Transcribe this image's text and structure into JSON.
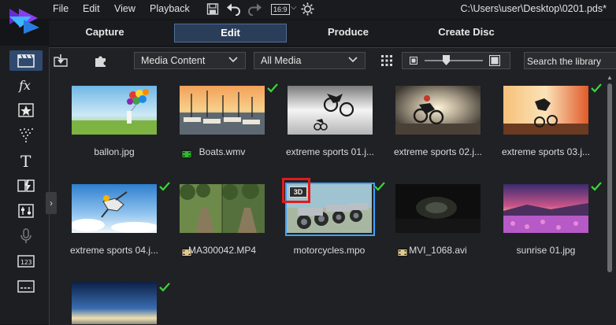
{
  "menu": {
    "items": [
      "File",
      "Edit",
      "View",
      "Playback"
    ],
    "aspect_ratio": "16:9",
    "project_path": "C:\\Users\\user\\Desktop\\0201.pds*"
  },
  "tabs": [
    "Capture",
    "Edit",
    "Produce",
    "Create Disc"
  ],
  "active_tab": "Edit",
  "left_toolbar": [
    "media-room-icon",
    "fx-room-icon",
    "pip-objects-icon",
    "particle-room-icon",
    "title-room-icon",
    "transition-room-icon",
    "audio-mixing-icon",
    "voiceover-icon",
    "chapter-room-icon",
    "subtitle-room-icon"
  ],
  "library": {
    "content_filter": "Media Content",
    "media_filter": "All Media",
    "search_placeholder": "Search the library",
    "items": [
      {
        "name": "ballon.jpg",
        "type": "image",
        "checked": false
      },
      {
        "name": "Boats.wmv",
        "type": "video",
        "checked": true
      },
      {
        "name": "extreme sports 01.j...",
        "type": "image",
        "checked": false
      },
      {
        "name": "extreme sports 02.j...",
        "type": "image",
        "checked": false
      },
      {
        "name": "extreme sports 03.j...",
        "type": "image",
        "checked": true
      },
      {
        "name": "extreme sports 04.j...",
        "type": "image",
        "checked": true
      },
      {
        "name": "MA300042.MP4",
        "type": "video",
        "checked": false
      },
      {
        "name": "motorcycles.mpo",
        "type": "image",
        "checked": true,
        "badge": "3D",
        "selected": true
      },
      {
        "name": "MVI_1068.avi",
        "type": "video",
        "checked": false
      },
      {
        "name": "sunrise 01.jpg",
        "type": "image",
        "checked": true
      },
      {
        "name": "",
        "type": "image",
        "checked": true
      }
    ]
  },
  "colors": {
    "accent": "#3ea2ff",
    "active_tab_bg": "#2a3d59",
    "highlight": "#e01b1b",
    "check_green": "#3ccf3c"
  }
}
